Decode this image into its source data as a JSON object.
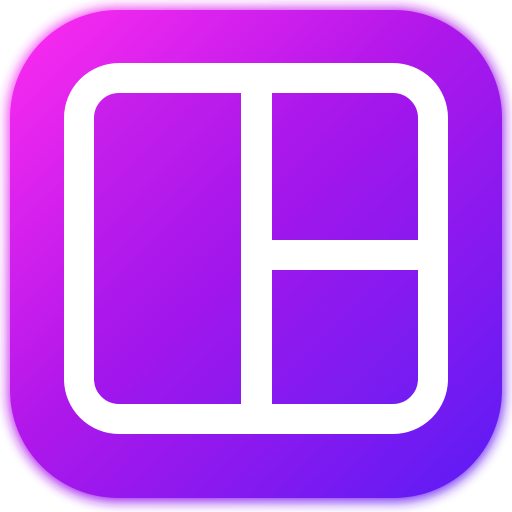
{
  "icon": {
    "name": "collage-layout-icon",
    "colors": {
      "gradient_top": "#ff2cf0",
      "gradient_mid": "#b017ea",
      "gradient_bottom": "#5a1cf5",
      "glyph": "#ffffff"
    }
  }
}
